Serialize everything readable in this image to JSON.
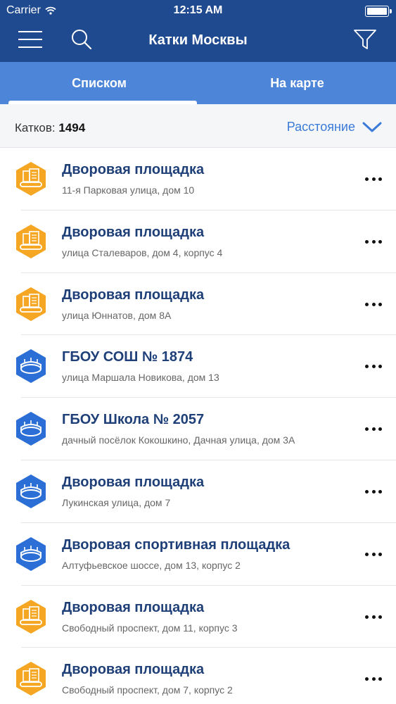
{
  "status_bar": {
    "carrier": "Carrier",
    "time": "12:15 AM"
  },
  "nav": {
    "title": "Катки Москвы",
    "menu_icon": "hamburger-menu-icon",
    "search_icon": "search-icon",
    "filter_icon": "filter-funnel-icon"
  },
  "tabs": {
    "list": "Списком",
    "map": "На карте",
    "active": "list"
  },
  "summary": {
    "count_label": "Катков:",
    "count_value": "1494",
    "sort_label": "Расстояние"
  },
  "colors": {
    "nav_bg": "#1f4a8f",
    "tabs_bg": "#4d86d9",
    "accent": "#3a7ad8",
    "title_text": "#1e3f78",
    "yard_icon": "#f5a623",
    "stadium_icon": "#2b6fd6"
  },
  "items": [
    {
      "title": "Дворовая площадка",
      "address": "11-я Парковая улица, дом 10",
      "icon": "yard-building-icon"
    },
    {
      "title": "Дворовая площадка",
      "address": "улица Сталеваров, дом 4, корпус 4",
      "icon": "yard-building-icon"
    },
    {
      "title": "Дворовая площадка",
      "address": "улица Юннатов, дом 8А",
      "icon": "yard-building-icon"
    },
    {
      "title": "ГБОУ СОШ № 1874",
      "address": "улица Маршала Новикова, дом 13",
      "icon": "stadium-icon"
    },
    {
      "title": "ГБОУ Школа № 2057",
      "address": "дачный посёлок Кокошкино, Дачная улица, дом 3А",
      "icon": "stadium-icon"
    },
    {
      "title": "Дворовая площадка",
      "address": "Лукинская улица, дом 7",
      "icon": "stadium-icon"
    },
    {
      "title": "Дворовая спортивная площадка",
      "address": "Алтуфьевское шоссе, дом 13, корпус 2",
      "icon": "stadium-icon"
    },
    {
      "title": "Дворовая площадка",
      "address": "Свободный проспект, дом 11, корпус 3",
      "icon": "yard-building-icon"
    },
    {
      "title": "Дворовая площадка",
      "address": "Свободный проспект, дом 7, корпус 2",
      "icon": "yard-building-icon"
    }
  ]
}
